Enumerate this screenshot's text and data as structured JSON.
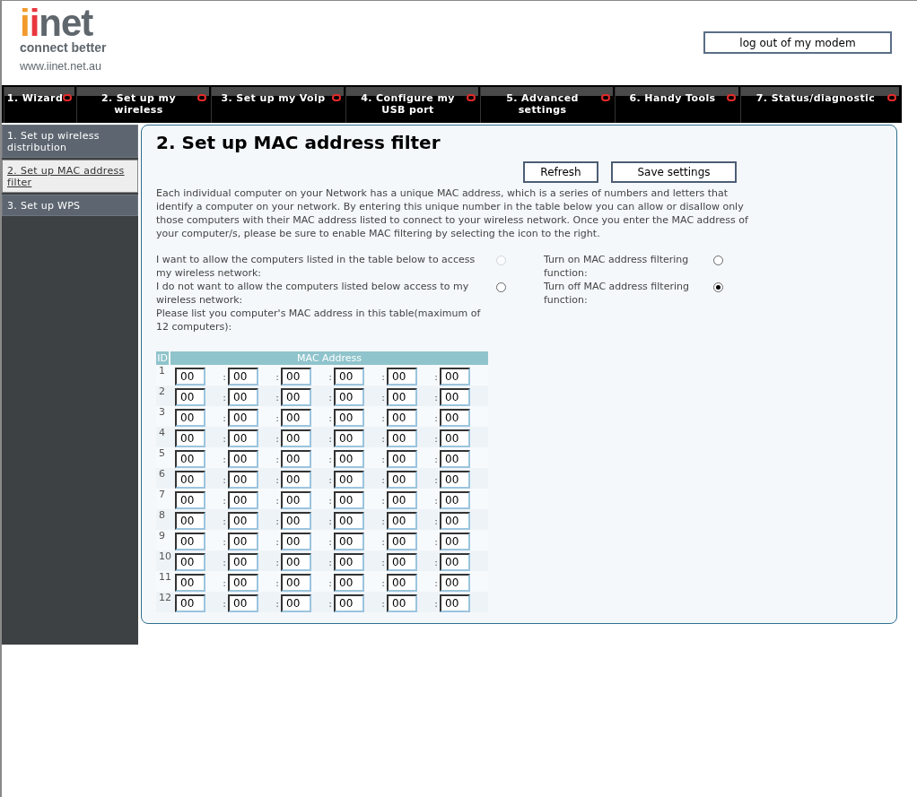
{
  "header": {
    "logo": {
      "parts": [
        {
          "text": "i",
          "color": "#f39a2e"
        },
        {
          "text": "i",
          "color": "#e8373f"
        },
        {
          "text": "net",
          "color": "#5f676d"
        }
      ],
      "tagline": "connect better"
    },
    "url": "www.iinet.net.au",
    "logout_button": "log out of my modem"
  },
  "tabs": [
    {
      "label": "1. Wizard"
    },
    {
      "label": "2. Set up my wireless"
    },
    {
      "label": "3. Set up my Voip"
    },
    {
      "label": "4. Configure my USB port"
    },
    {
      "label": "5. Advanced settings"
    },
    {
      "label": "6. Handy Tools"
    },
    {
      "label": "7. Status/diagnostic"
    }
  ],
  "sidebar": {
    "items": [
      {
        "label": "1. Set up wireless distribution",
        "selected": false
      },
      {
        "label": "2. Set up MAC address filter",
        "selected": true
      },
      {
        "label": "3. Set up WPS",
        "selected": false
      }
    ]
  },
  "content": {
    "title": "2. Set up MAC address filter",
    "buttons": [
      "Refresh",
      "Save settings"
    ],
    "description": "Each individual computer on your Network has a unique MAC address, which is a series of numbers and letters that identify a computer on your network. By entering this unique number in the table below you can allow or disallow only those computers with their MAC address listed to connect to your wireless network. Once you enter the MAC address of your computer/s, please be sure to enable MAC filtering by selecting the icon to the right.",
    "access_options": [
      {
        "label": "I want to allow the computers listed in the table below to access my wireless network:",
        "selected": false,
        "disabled": true
      },
      {
        "label": "I do not want to allow the computers listed below access to my wireless network:",
        "selected": false,
        "disabled": false
      }
    ],
    "filter_options": [
      {
        "label": "Turn on MAC address filtering function:",
        "selected": false
      },
      {
        "label": "Turn off MAC address filtering function:",
        "selected": true
      }
    ],
    "list_note": "Please list you computer's MAC address in this table(maximum of 12 computers):",
    "table": {
      "columns": [
        "ID",
        "MAC Address"
      ],
      "rows": [
        {
          "id": "1",
          "octets": [
            "00",
            "00",
            "00",
            "00",
            "00",
            "00"
          ],
          "separators": [
            ":",
            ":",
            ":",
            ":",
            ":"
          ]
        },
        {
          "id": "2",
          "octets": [
            "00",
            "00",
            "00",
            "00",
            "00",
            "00"
          ],
          "separators": [
            ":",
            ":",
            ":",
            ":",
            ":"
          ]
        },
        {
          "id": "3",
          "octets": [
            "00",
            "00",
            "00",
            "00",
            "00",
            "00"
          ],
          "separators": [
            ":",
            ":",
            ":",
            ":",
            ":"
          ]
        },
        {
          "id": "4",
          "octets": [
            "00",
            "00",
            "00",
            "00",
            "00",
            "00"
          ],
          "separators": [
            ":",
            ":",
            ":",
            ":",
            ":"
          ]
        },
        {
          "id": "5",
          "octets": [
            "00",
            "00",
            "00",
            "00",
            "00",
            "00"
          ],
          "separators": [
            ":",
            ":",
            ":",
            ":",
            ":"
          ]
        },
        {
          "id": "6",
          "octets": [
            "00",
            "00",
            "00",
            "00",
            "00",
            "00"
          ],
          "separators": [
            ":",
            ":",
            ":",
            ":",
            ":"
          ]
        },
        {
          "id": "7",
          "octets": [
            "00",
            "00",
            "00",
            "00",
            "00",
            "00"
          ],
          "separators": [
            ":",
            ":",
            ":",
            ":",
            ":"
          ]
        },
        {
          "id": "8",
          "octets": [
            "00",
            "00",
            "00",
            "00",
            "00",
            "00"
          ],
          "separators": [
            ":",
            ":",
            ":",
            ":",
            ":"
          ]
        },
        {
          "id": "9",
          "octets": [
            "00",
            "00",
            "00",
            "00",
            "00",
            "00"
          ],
          "separators": [
            ":",
            ":",
            ":",
            ":",
            ":"
          ]
        },
        {
          "id": "10",
          "octets": [
            "00",
            "00",
            "00",
            "00",
            "00",
            "00"
          ],
          "separators": [
            ":",
            ":",
            ":",
            ":",
            ":"
          ]
        },
        {
          "id": "11",
          "octets": [
            "00",
            "00",
            "00",
            "00",
            "00",
            "00"
          ],
          "separators": [
            ":",
            ":",
            ":",
            ":",
            ":"
          ]
        },
        {
          "id": "12",
          "octets": [
            "00",
            "00",
            "00",
            "00",
            "00",
            "00"
          ],
          "separators": [
            ":",
            ":",
            ":",
            ":",
            ":"
          ]
        }
      ]
    }
  }
}
